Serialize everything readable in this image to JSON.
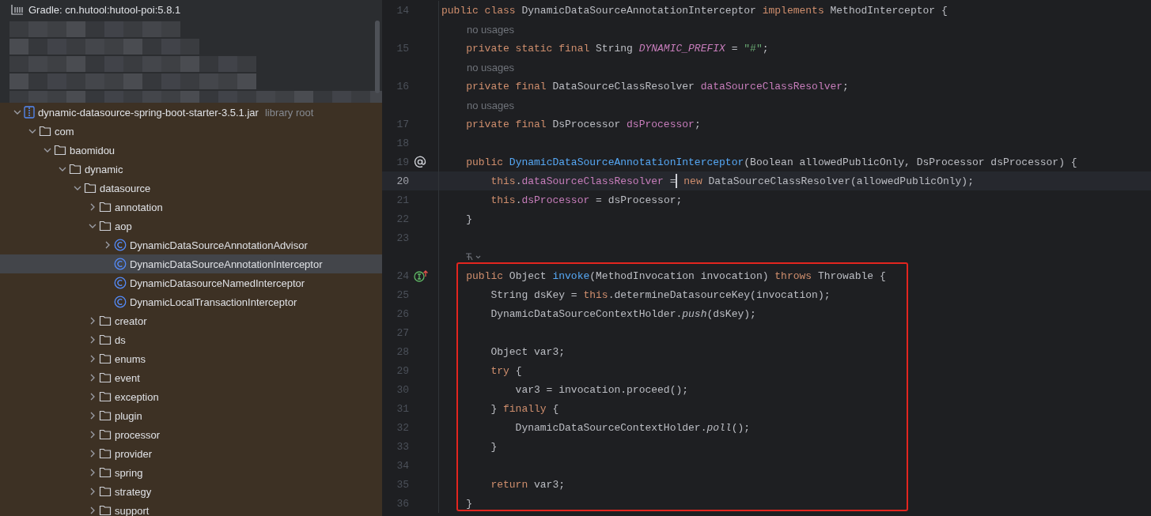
{
  "project_tree": {
    "header": {
      "label": "Gradle: cn.hutool:hutool-poi:5.8.1"
    },
    "items": [
      {
        "label": "dynamic-datasource-spring-boot-starter-3.5.1.jar",
        "suffix": "library root",
        "kind": "jar",
        "expanded": true,
        "selected": false,
        "children": [
          {
            "label": "com",
            "kind": "folder",
            "expanded": true,
            "selected": false,
            "children": [
              {
                "label": "baomidou",
                "kind": "folder",
                "expanded": true,
                "selected": false,
                "children": [
                  {
                    "label": "dynamic",
                    "kind": "folder",
                    "expanded": true,
                    "selected": false,
                    "children": [
                      {
                        "label": "datasource",
                        "kind": "folder",
                        "expanded": true,
                        "selected": false,
                        "children": [
                          {
                            "label": "annotation",
                            "kind": "folder",
                            "expanded": false,
                            "selected": false
                          },
                          {
                            "label": "aop",
                            "kind": "folder",
                            "expanded": true,
                            "selected": false,
                            "children": [
                              {
                                "label": "DynamicDataSourceAnnotationAdvisor",
                                "kind": "class",
                                "expanded": false,
                                "selected": false
                              },
                              {
                                "label": "DynamicDataSourceAnnotationInterceptor",
                                "kind": "class",
                                "selected": true
                              },
                              {
                                "label": "DynamicDatasourceNamedInterceptor",
                                "kind": "class",
                                "selected": false
                              },
                              {
                                "label": "DynamicLocalTransactionInterceptor",
                                "kind": "class",
                                "selected": false
                              }
                            ]
                          },
                          {
                            "label": "creator",
                            "kind": "folder",
                            "expanded": false,
                            "selected": false
                          },
                          {
                            "label": "ds",
                            "kind": "folder",
                            "expanded": false,
                            "selected": false
                          },
                          {
                            "label": "enums",
                            "kind": "folder",
                            "expanded": false,
                            "selected": false
                          },
                          {
                            "label": "event",
                            "kind": "folder",
                            "expanded": false,
                            "selected": false
                          },
                          {
                            "label": "exception",
                            "kind": "folder",
                            "expanded": false,
                            "selected": false
                          },
                          {
                            "label": "plugin",
                            "kind": "folder",
                            "expanded": false,
                            "selected": false
                          },
                          {
                            "label": "processor",
                            "kind": "folder",
                            "expanded": false,
                            "selected": false
                          },
                          {
                            "label": "provider",
                            "kind": "folder",
                            "expanded": false,
                            "selected": false
                          },
                          {
                            "label": "spring",
                            "kind": "folder",
                            "expanded": false,
                            "selected": false
                          },
                          {
                            "label": "strategy",
                            "kind": "folder",
                            "expanded": false,
                            "selected": false
                          },
                          {
                            "label": "support",
                            "kind": "folder",
                            "expanded": false,
                            "selected": false
                          }
                        ]
                      }
                    ]
                  }
                ]
              }
            ]
          }
        ]
      }
    ]
  },
  "editor": {
    "lines": [
      {
        "kind": "code",
        "number": "14",
        "current": false,
        "boxed": false,
        "tokens": [
          {
            "text": "public class ",
            "kind": "keyword"
          },
          {
            "text": "DynamicDataSourceAnnotationInterceptor ",
            "kind": "plain"
          },
          {
            "text": "implements ",
            "kind": "keyword"
          },
          {
            "text": "MethodInterceptor {",
            "kind": "plain"
          }
        ]
      },
      {
        "kind": "hint",
        "text": "no usages"
      },
      {
        "kind": "code",
        "number": "15",
        "current": false,
        "boxed": false,
        "tokens": [
          {
            "text": "    private static final ",
            "kind": "keyword"
          },
          {
            "text": "String ",
            "kind": "plain"
          },
          {
            "text": "DYNAMIC_PREFIX",
            "kind": "static_field"
          },
          {
            "text": " = ",
            "kind": "plain"
          },
          {
            "text": "\"#\"",
            "kind": "string"
          },
          {
            "text": ";",
            "kind": "plain"
          }
        ]
      },
      {
        "kind": "hint",
        "text": "no usages"
      },
      {
        "kind": "code",
        "number": "16",
        "current": false,
        "boxed": false,
        "tokens": [
          {
            "text": "    private final ",
            "kind": "keyword"
          },
          {
            "text": "DataSourceClassResolver ",
            "kind": "plain"
          },
          {
            "text": "dataSourceClassResolver",
            "kind": "field"
          },
          {
            "text": ";",
            "kind": "plain"
          }
        ]
      },
      {
        "kind": "hint",
        "text": "no usages"
      },
      {
        "kind": "code",
        "number": "17",
        "current": false,
        "boxed": false,
        "tokens": [
          {
            "text": "    private final ",
            "kind": "keyword"
          },
          {
            "text": "DsProcessor ",
            "kind": "plain"
          },
          {
            "text": "dsProcessor",
            "kind": "field"
          },
          {
            "text": ";",
            "kind": "plain"
          }
        ]
      },
      {
        "kind": "code",
        "number": "18",
        "current": false,
        "boxed": false
      },
      {
        "kind": "code",
        "number": "19",
        "current": false,
        "boxed": false,
        "gutter_icon": {
          "kind": "annotation"
        },
        "tokens": [
          {
            "text": "    public ",
            "kind": "keyword"
          },
          {
            "text": "DynamicDataSourceAnnotationInterceptor",
            "kind": "method"
          },
          {
            "text": "(Boolean allowedPublicOnly, DsProcessor dsProcessor) {",
            "kind": "plain"
          }
        ]
      },
      {
        "kind": "code",
        "number": "20",
        "current": true,
        "boxed": false,
        "tokens": [
          {
            "text": "        this",
            "kind": "keyword"
          },
          {
            "text": ".",
            "kind": "plain"
          },
          {
            "text": "dataSourceClassResolver",
            "kind": "field"
          },
          {
            "text": " =",
            "kind": "plain",
            "caret": true
          },
          {
            "text": " new ",
            "kind": "keyword"
          },
          {
            "text": "DataSourceClassResolver(allowedPublicOnly);",
            "kind": "plain"
          }
        ]
      },
      {
        "kind": "code",
        "number": "21",
        "current": false,
        "boxed": false,
        "tokens": [
          {
            "text": "        this",
            "kind": "keyword"
          },
          {
            "text": ".",
            "kind": "plain"
          },
          {
            "text": "dsProcessor",
            "kind": "field"
          },
          {
            "text": " = dsProcessor;",
            "kind": "plain"
          }
        ]
      },
      {
        "kind": "code",
        "number": "22",
        "current": false,
        "boxed": false,
        "tokens": [
          {
            "text": "    }",
            "kind": "plain"
          }
        ]
      },
      {
        "kind": "code",
        "number": "23",
        "current": false,
        "boxed": false
      },
      {
        "kind": "icon_hint"
      },
      {
        "kind": "code",
        "number": "24",
        "current": false,
        "boxed": true,
        "gutter_icon": {
          "kind": "implementing"
        },
        "tokens": [
          {
            "text": "    public ",
            "kind": "keyword"
          },
          {
            "text": "Object ",
            "kind": "plain"
          },
          {
            "text": "invoke",
            "kind": "method"
          },
          {
            "text": "(MethodInvocation invocation) ",
            "kind": "plain"
          },
          {
            "text": "throws ",
            "kind": "keyword"
          },
          {
            "text": "Throwable {",
            "kind": "plain"
          }
        ]
      },
      {
        "kind": "code",
        "number": "25",
        "current": false,
        "boxed": true,
        "tokens": [
          {
            "text": "        String dsKey = ",
            "kind": "plain"
          },
          {
            "text": "this",
            "kind": "keyword"
          },
          {
            "text": ".determineDatasourceKey(invocation);",
            "kind": "plain"
          }
        ]
      },
      {
        "kind": "code",
        "number": "26",
        "current": false,
        "boxed": true,
        "tokens": [
          {
            "text": "        DynamicDataSourceContextHolder.",
            "kind": "plain"
          },
          {
            "text": "push",
            "kind": "static_call"
          },
          {
            "text": "(dsKey);",
            "kind": "plain"
          }
        ]
      },
      {
        "kind": "code",
        "number": "27",
        "current": false,
        "boxed": true
      },
      {
        "kind": "code",
        "number": "28",
        "current": false,
        "boxed": true,
        "tokens": [
          {
            "text": "        Object var3;",
            "kind": "plain"
          }
        ]
      },
      {
        "kind": "code",
        "number": "29",
        "current": false,
        "boxed": true,
        "tokens": [
          {
            "text": "        try",
            "kind": "keyword"
          },
          {
            "text": " {",
            "kind": "plain"
          }
        ]
      },
      {
        "kind": "code",
        "number": "30",
        "current": false,
        "boxed": true,
        "tokens": [
          {
            "text": "            var3 = invocation.proceed();",
            "kind": "plain"
          }
        ]
      },
      {
        "kind": "code",
        "number": "31",
        "current": false,
        "boxed": true,
        "tokens": [
          {
            "text": "        } ",
            "kind": "plain"
          },
          {
            "text": "finally",
            "kind": "keyword"
          },
          {
            "text": " {",
            "kind": "plain"
          }
        ]
      },
      {
        "kind": "code",
        "number": "32",
        "current": false,
        "boxed": true,
        "tokens": [
          {
            "text": "            DynamicDataSourceContextHolder.",
            "kind": "plain"
          },
          {
            "text": "poll",
            "kind": "static_call"
          },
          {
            "text": "();",
            "kind": "plain"
          }
        ]
      },
      {
        "kind": "code",
        "number": "33",
        "current": false,
        "boxed": true,
        "tokens": [
          {
            "text": "        }",
            "kind": "plain"
          }
        ]
      },
      {
        "kind": "code",
        "number": "34",
        "current": false,
        "boxed": true
      },
      {
        "kind": "code",
        "number": "35",
        "current": false,
        "boxed": true,
        "tokens": [
          {
            "text": "        return",
            "kind": "keyword"
          },
          {
            "text": " var3;",
            "kind": "plain"
          }
        ]
      },
      {
        "kind": "code",
        "number": "36",
        "current": false,
        "boxed": true,
        "tokens": [
          {
            "text": "    }",
            "kind": "plain"
          }
        ]
      }
    ]
  }
}
